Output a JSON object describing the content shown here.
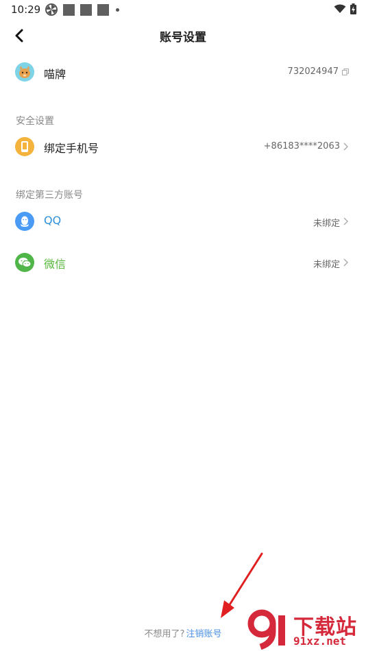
{
  "status_bar": {
    "time": "10:29"
  },
  "header": {
    "title": "账号设置"
  },
  "profile": {
    "nickname": "喵牌",
    "user_id": "732024947"
  },
  "security": {
    "section_title": "安全设置",
    "phone": {
      "label": "绑定手机号",
      "value": "+86183****2063"
    }
  },
  "third_party": {
    "section_title": "绑定第三方账号",
    "qq": {
      "label": "QQ",
      "value": "未绑定"
    },
    "wechat": {
      "label": "微信",
      "value": "未绑定"
    }
  },
  "footer": {
    "prompt": "不想用了?",
    "link": "注销账号"
  },
  "watermark": {
    "title": "下载站",
    "url": "91xz.net"
  },
  "colors": {
    "qq_blue": "#4a9bf5",
    "qq_label": "#2f8fd8",
    "wechat_green": "#50b64a",
    "wechat_label": "#56b73c",
    "phone_orange": "#f3b33c",
    "link_blue": "#4a90e2",
    "watermark_red": "#d5283a"
  },
  "icons": {
    "back": "chevron-left-icon",
    "copy": "copy-icon",
    "chevron": "chevron-right-icon",
    "phone": "phone-icon",
    "qq": "qq-penguin-icon",
    "wechat": "wechat-bubbles-icon"
  }
}
